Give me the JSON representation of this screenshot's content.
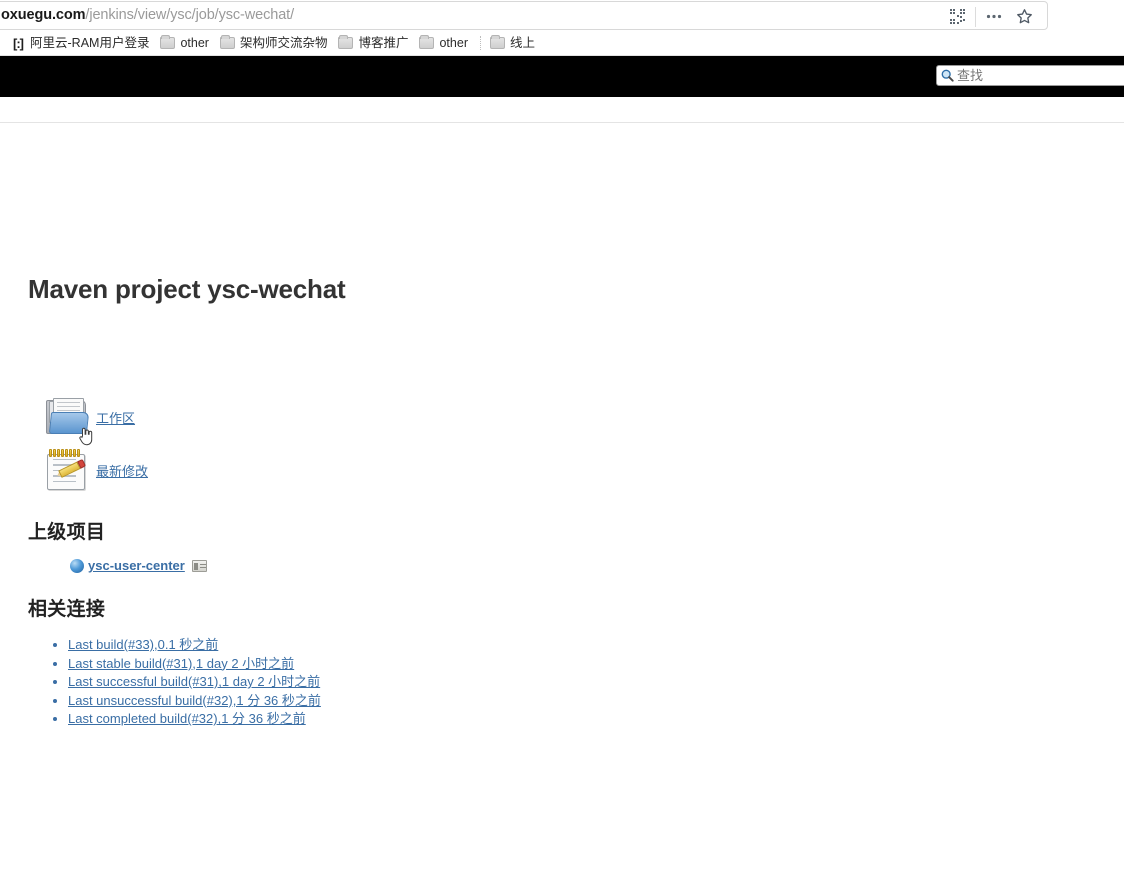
{
  "browser": {
    "url": {
      "domain": "oxuegu.com",
      "path": "/jenkins/view/ysc/job/ysc-wechat/",
      "full": "oxuegu.com/jenkins/view/ysc/job/ysc-wechat/"
    },
    "urlbar_icons": [
      {
        "name": "qr-code-icon",
        "glyph": "▦"
      },
      {
        "name": "more-options-icon",
        "glyph": "•••"
      },
      {
        "name": "bookmark-star-icon",
        "glyph": "☆"
      }
    ],
    "bookmarks": [
      {
        "label": "阿里云-RAM用户登录",
        "icon": "cloud-icon"
      },
      {
        "label": "other",
        "icon": "folder-icon"
      },
      {
        "label": "架构师交流杂物",
        "icon": "folder-icon"
      },
      {
        "label": "博客推广",
        "icon": "folder-icon"
      },
      {
        "label": "other",
        "icon": "folder-icon"
      },
      {
        "label": "线上",
        "icon": "folder-icon"
      }
    ]
  },
  "header": {
    "background": "#000000",
    "search": {
      "placeholder": "查找",
      "value": "",
      "icon": "search-icon"
    }
  },
  "page": {
    "title": "Maven project ysc-wechat",
    "icon_links": [
      {
        "label": "工作区",
        "icon": "folder-workspace-icon"
      },
      {
        "label": "最新修改",
        "icon": "notepad-pencil-icon"
      }
    ],
    "upstream": {
      "heading": "上级项目",
      "project": "ysc-user-center",
      "status_icon": "blue-ball-icon",
      "console_icon": "console-output-icon"
    },
    "related": {
      "heading": "相关连接",
      "items": [
        "Last build(#33),0.1 秒之前",
        "Last stable build(#31),1 day 2 小时之前",
        "Last successful build(#31),1 day 2 小时之前",
        "Last unsuccessful build(#32),1 分 36 秒之前",
        "Last completed build(#32),1 分 36 秒之前"
      ]
    }
  },
  "colors": {
    "link": "#3a6ea5",
    "header_bg": "#000000",
    "title": "#333333"
  }
}
